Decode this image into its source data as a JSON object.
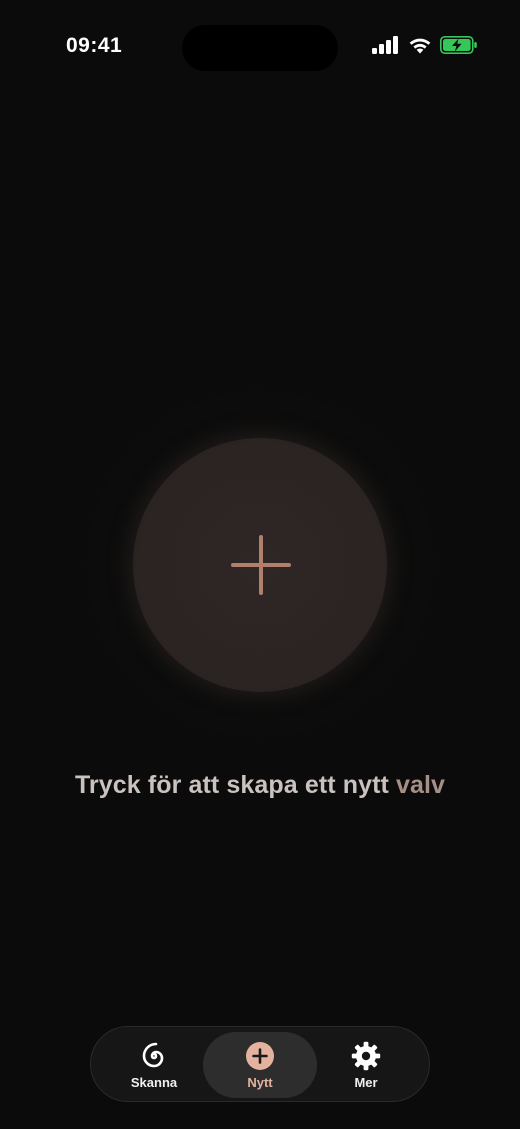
{
  "status_bar": {
    "time": "09:41",
    "icons": [
      "signal-icon",
      "wifi-icon",
      "battery-charging-icon"
    ]
  },
  "main": {
    "create_button_icon": "plus-icon",
    "hint_prefix": "Tryck för att skapa ett nytt ",
    "hint_accent": "valv"
  },
  "tab_bar": {
    "tabs": [
      {
        "label": "Skanna",
        "icon": "spiral-icon",
        "selected": false
      },
      {
        "label": "Nytt",
        "icon": "plus-circle-icon",
        "selected": true
      },
      {
        "label": "Mer",
        "icon": "gear-icon",
        "selected": false
      }
    ]
  },
  "colors": {
    "background": "#0b0b0b",
    "accent": "#e4b3a0",
    "battery": "#35c759"
  }
}
